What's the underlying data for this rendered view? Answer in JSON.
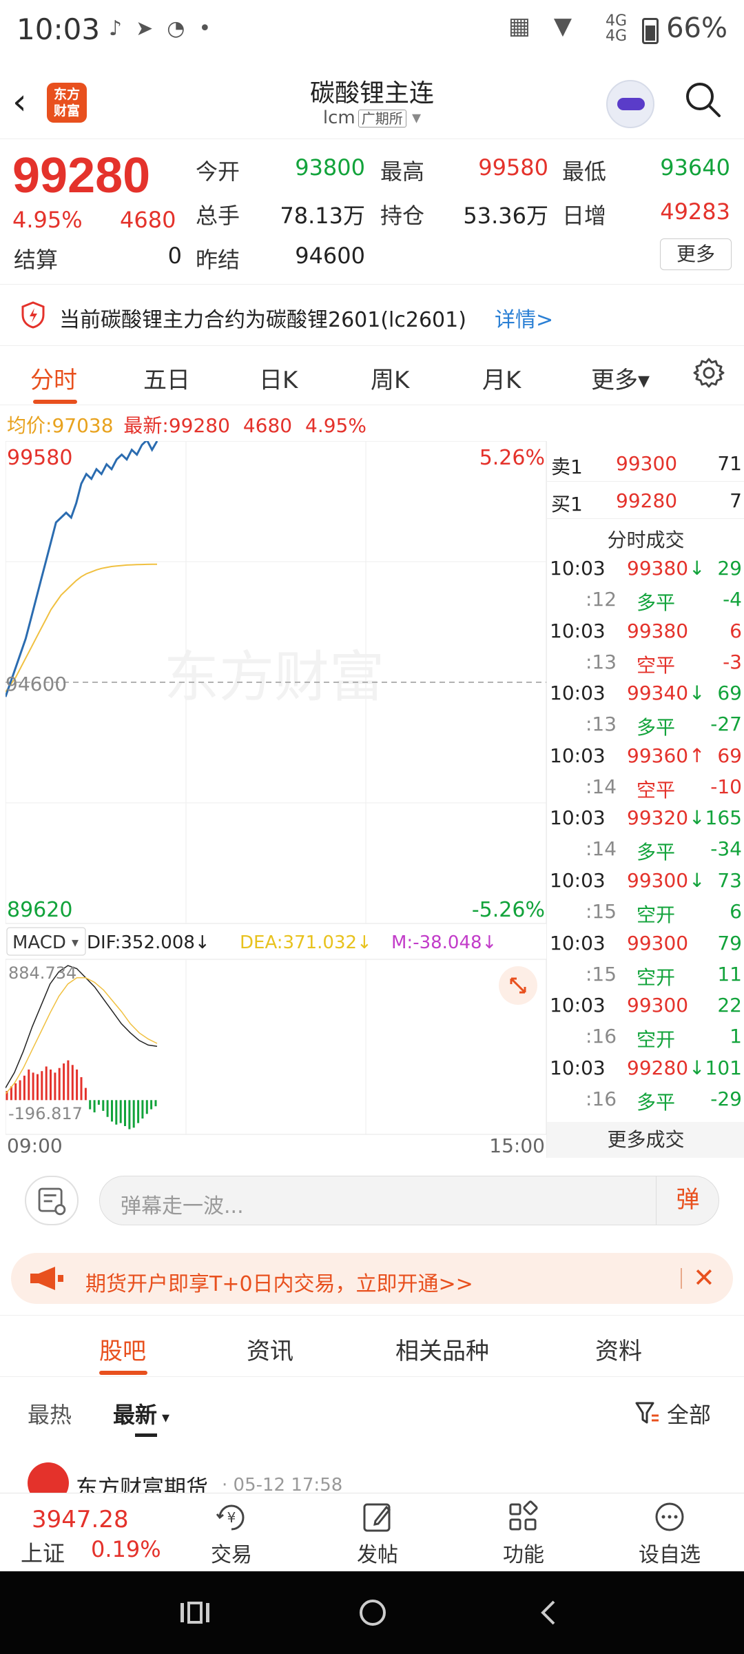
{
  "status_bar": {
    "time": "10:03",
    "icons": [
      "tiktok-icon",
      "paper-plane-icon",
      "circle-app-icon",
      "dot-icon"
    ],
    "network": "4G",
    "network2": "4G",
    "battery": "66%"
  },
  "header": {
    "logo_line1": "东方",
    "logo_line2": "财富",
    "title": "碳酸锂主连",
    "code": "lcm",
    "exchange": "广期所"
  },
  "quote": {
    "price": "99280",
    "pct": "4.95%",
    "change": "4680",
    "open_label": "今开",
    "open": "93800",
    "high_label": "最高",
    "high": "99580",
    "low_label": "最低",
    "low": "93640",
    "volume_label": "总手",
    "volume": "78.13万",
    "oi_label": "持仓",
    "oi": "53.36万",
    "daily_inc_label": "日增",
    "daily_inc": "49283",
    "settle_label": "结算",
    "settle": "0",
    "prev_settle_label": "昨结",
    "prev_settle": "94600",
    "more": "更多"
  },
  "notice": {
    "text": "当前碳酸锂主力合约为碳酸锂2601(lc2601)",
    "link": "详情>"
  },
  "tabs": [
    "分时",
    "五日",
    "日K",
    "周K",
    "月K",
    "更多▾"
  ],
  "avg_line": {
    "avg_label": "均价:",
    "avg": "97038",
    "last_label": "最新:",
    "last": "99280",
    "chg": "4680",
    "pct": "4.95%"
  },
  "chart_data": {
    "type": "line",
    "title": "",
    "y_top": "99580",
    "y_mid": "94600",
    "y_bottom": "89620",
    "pct_top": "5.26%",
    "pct_bottom": "-5.26%",
    "ylim": [
      89620,
      99580
    ],
    "x_start": "09:00",
    "x_end": "15:00",
    "price_series": [
      94300,
      94600,
      94900,
      95200,
      95500,
      95900,
      96300,
      96700,
      97100,
      97500,
      97900,
      98000,
      98100,
      98000,
      98300,
      98700,
      98900,
      98800,
      99000,
      98900,
      99100,
      99000,
      99200,
      99300,
      99200,
      99400,
      99300,
      99500,
      99600,
      99400,
      99580
    ],
    "avg_series": [
      94400,
      94550,
      94700,
      94900,
      95100,
      95300,
      95500,
      95700,
      95900,
      96100,
      96250,
      96400,
      96500,
      96600,
      96700,
      96780,
      96840,
      96880,
      96920,
      96950,
      96970,
      96990,
      97000,
      97010,
      97020,
      97025,
      97030,
      97032,
      97034,
      97036,
      97038
    ],
    "watermark": "东方财富",
    "macd": {
      "label": "MACD",
      "dif_label": "DIF:352.008↓",
      "dea_label": "DEA:371.032↓",
      "m_label": "M:-38.048↓",
      "max": "884.734",
      "min": "-196.817",
      "ylim": [
        -196.817,
        884.734
      ],
      "dif_series": [
        80,
        180,
        320,
        480,
        620,
        760,
        840,
        880,
        860,
        800,
        740,
        660,
        580,
        500,
        440,
        390,
        360,
        352
      ],
      "dea_series": [
        40,
        110,
        210,
        330,
        450,
        570,
        680,
        760,
        800,
        800,
        770,
        720,
        650,
        580,
        500,
        440,
        400,
        371
      ],
      "hist": [
        60,
        90,
        110,
        130,
        160,
        200,
        180,
        170,
        190,
        220,
        200,
        180,
        210,
        240,
        260,
        230,
        200,
        150,
        80,
        -60,
        -80,
        -30,
        -70,
        -110,
        -140,
        -160,
        -150,
        -170,
        -190,
        -180,
        -150,
        -120,
        -90,
        -60,
        -40
      ]
    }
  },
  "orderbook": {
    "sell_label": "卖1",
    "sell_price": "99300",
    "sell_vol": "71",
    "buy_label": "买1",
    "buy_price": "99280",
    "buy_vol": "7",
    "ticks_title": "分时成交",
    "ticks": [
      {
        "t": "10:03",
        "p": "99380",
        "arrow": "↓",
        "v": "29",
        "sub_t": ":12",
        "kind": "多平",
        "kv": "-4",
        "pc": "red",
        "ac": "green",
        "vc": "green",
        "kc": "green",
        "kvc": "green"
      },
      {
        "t": "10:03",
        "p": "99380",
        "arrow": "",
        "v": "6",
        "sub_t": ":13",
        "kind": "空平",
        "kv": "-3",
        "pc": "red",
        "ac": "",
        "vc": "red",
        "kc": "red",
        "kvc": "red"
      },
      {
        "t": "10:03",
        "p": "99340",
        "arrow": "↓",
        "v": "69",
        "sub_t": ":13",
        "kind": "多平",
        "kv": "-27",
        "pc": "red",
        "ac": "green",
        "vc": "green",
        "kc": "green",
        "kvc": "green"
      },
      {
        "t": "10:03",
        "p": "99360",
        "arrow": "↑",
        "v": "69",
        "sub_t": ":14",
        "kind": "空平",
        "kv": "-10",
        "pc": "red",
        "ac": "red",
        "vc": "red",
        "kc": "red",
        "kvc": "red"
      },
      {
        "t": "10:03",
        "p": "99320",
        "arrow": "↓",
        "v": "165",
        "sub_t": ":14",
        "kind": "多平",
        "kv": "-34",
        "pc": "red",
        "ac": "green",
        "vc": "green",
        "kc": "green",
        "kvc": "green"
      },
      {
        "t": "10:03",
        "p": "99300",
        "arrow": "↓",
        "v": "73",
        "sub_t": ":15",
        "kind": "空开",
        "kv": "6",
        "pc": "red",
        "ac": "green",
        "vc": "green",
        "kc": "green",
        "kvc": "green"
      },
      {
        "t": "10:03",
        "p": "99300",
        "arrow": "",
        "v": "79",
        "sub_t": ":15",
        "kind": "空开",
        "kv": "11",
        "pc": "red",
        "ac": "",
        "vc": "green",
        "kc": "green",
        "kvc": "green"
      },
      {
        "t": "10:03",
        "p": "99300",
        "arrow": "",
        "v": "22",
        "sub_t": ":16",
        "kind": "空开",
        "kv": "1",
        "pc": "red",
        "ac": "",
        "vc": "green",
        "kc": "green",
        "kvc": "green"
      },
      {
        "t": "10:03",
        "p": "99280",
        "arrow": "↓",
        "v": "101",
        "sub_t": ":16",
        "kind": "多平",
        "kv": "-29",
        "pc": "red",
        "ac": "green",
        "vc": "green",
        "kc": "green",
        "kvc": "green"
      }
    ],
    "more_ticks": "更多成交"
  },
  "danmaku": {
    "placeholder": "弹幕走一波...",
    "button": "弹"
  },
  "promo": {
    "text": "期货开户即享T+0日内交易，立即开通>>"
  },
  "bottom_tabs": [
    "股吧",
    "资讯",
    "相关品种",
    "资料"
  ],
  "filter": {
    "hot": "最热",
    "latest": "最新",
    "all": "全部"
  },
  "feed": {
    "name": "东方财富期货",
    "time": "· 05-12 17:58"
  },
  "toolbar": {
    "index_value": "3947.28",
    "index_name": "上证",
    "index_pct": "0.19%",
    "trade": "交易",
    "post": "发帖",
    "func": "功能",
    "watch": "设自选"
  },
  "colors": {
    "red": "#e4322b",
    "green": "#12a33b",
    "accent": "#e8501e",
    "price_line": "#2b6cb0",
    "avg_line": "#f0c040",
    "link": "#2a7fd4"
  }
}
